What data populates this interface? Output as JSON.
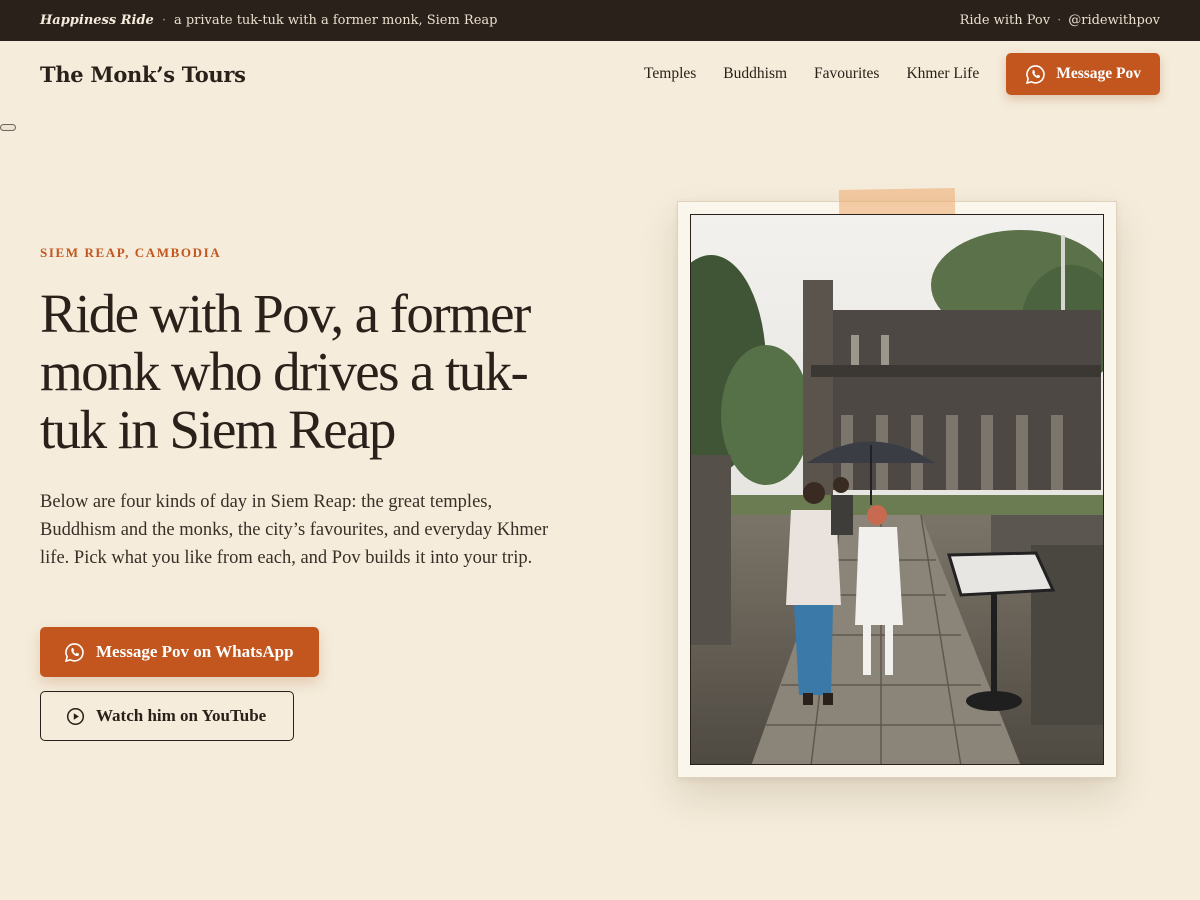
{
  "topbar": {
    "brand": "Happiness Ride",
    "tagline": "a private tuk-tuk with a former monk, Siem Reap",
    "right_name": "Ride with Pov",
    "right_handle": "@ridewithpov"
  },
  "nav": {
    "logo": "The Monk’s Tours",
    "links": [
      "Temples",
      "Buddhism",
      "Favourites",
      "Khmer Life"
    ],
    "cta_label": "Message Pov"
  },
  "hero": {
    "eyebrow": "SIEM REAP, CAMBODIA",
    "title": "Ride with Pov, a former monk who drives a tuk-tuk in Siem Reap",
    "body": "Below are four kinds of day in Siem Reap: the great temples, Buddhism and the monks, the city’s favourites, and everyday Khmer life. Pick what you like from each, and Pov builds it into your trip.",
    "primary_cta": "Message Pov on WhatsApp",
    "secondary_cta": "Watch him on YouTube"
  },
  "icons": {
    "whatsapp": "whatsapp-icon",
    "play": "play-circle-icon"
  },
  "colors": {
    "accent": "#c2561e",
    "background": "#f5ecdb",
    "topbar": "#2b211b",
    "text": "#2a211a"
  }
}
